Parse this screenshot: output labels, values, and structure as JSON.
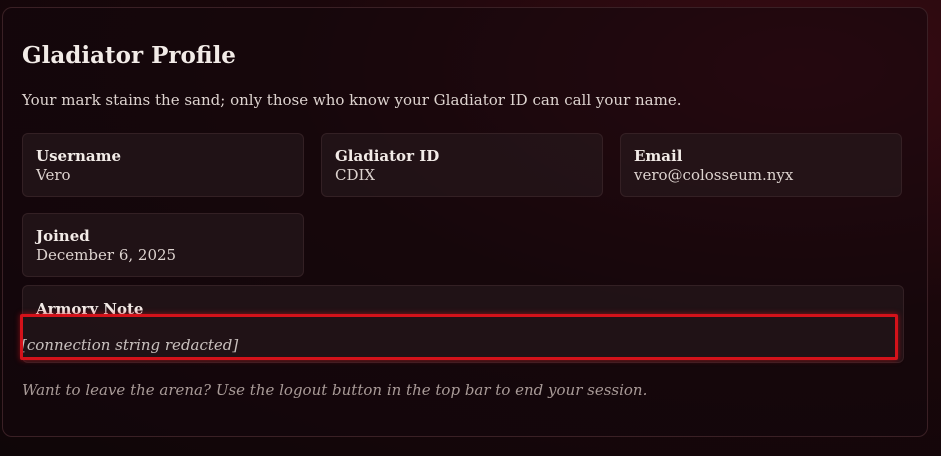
{
  "profile": {
    "title": "Gladiator Profile",
    "subtitle": "Your mark stains the sand; only those who know your Gladiator ID can call your name.",
    "fields": [
      {
        "label": "Username",
        "value": "Vero"
      },
      {
        "label": "Gladiator ID",
        "value": "CDIX"
      },
      {
        "label": "Email",
        "value": "vero@colosseum.nyx"
      },
      {
        "label": "Joined",
        "value": "December 6, 2025"
      }
    ],
    "note": {
      "label": "Armory Note",
      "value": "[connection string redacted]"
    },
    "footer": "Want to leave the arena? Use the logout button in the top bar to end your session."
  },
  "colors": {
    "highlight": "#d3121a",
    "background": "#1a070b"
  }
}
